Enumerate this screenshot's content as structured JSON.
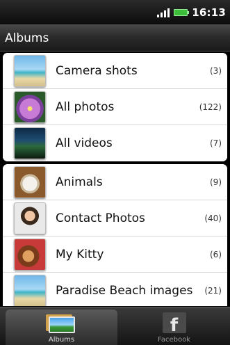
{
  "status_bar": {
    "time": "16:13",
    "signal_icon": "signal-bars-icon",
    "battery_icon": "battery-icon"
  },
  "header": {
    "title": "Albums"
  },
  "albums": {
    "top_group": [
      {
        "label": "Camera shots",
        "count": "(3)",
        "thumbnail": "beach-thumbnail"
      },
      {
        "label": "All photos",
        "count": "(122)",
        "thumbnail": "flower-thumbnail"
      },
      {
        "label": "All videos",
        "count": "(7)",
        "thumbnail": "video-thumbnail"
      }
    ],
    "bottom_group": [
      {
        "label": "Animals",
        "count": "(9)",
        "thumbnail": "dog-thumbnail"
      },
      {
        "label": "Contact Photos",
        "count": "(40)",
        "thumbnail": "person-thumbnail"
      },
      {
        "label": "My Kitty",
        "count": "(6)",
        "thumbnail": "cat-thumbnail"
      },
      {
        "label": "Paradise Beach images",
        "count": "(21)",
        "thumbnail": "beach-thumbnail"
      }
    ]
  },
  "tabs": [
    {
      "label": "Albums",
      "icon": "albums-icon",
      "active": true
    },
    {
      "label": "Facebook",
      "icon": "facebook-icon",
      "active": false
    }
  ],
  "colors": {
    "list_bg": "#ffffff",
    "chrome_dark": "#1a1a1a",
    "text": "#111111"
  }
}
